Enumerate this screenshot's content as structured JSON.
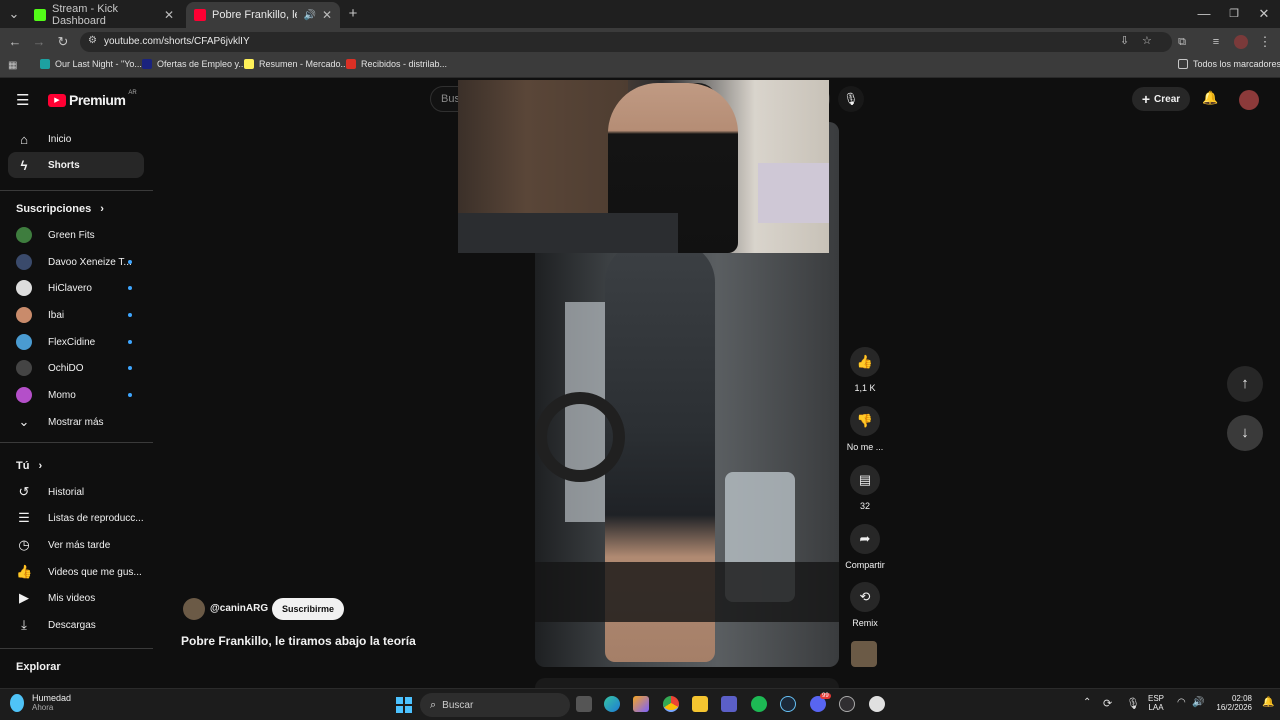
{
  "browser": {
    "tabs": [
      {
        "title": "Stream - Kick Dashboard",
        "favicon_color": "#53fc18",
        "active": false
      },
      {
        "title": "Pobre Frankillo, le tiramos a",
        "favicon_color": "#ff0033",
        "active": true
      }
    ],
    "new_tab_icon": "plus-icon",
    "url": "youtube.com/shorts/CFAP6jvklIY",
    "bookmarks": [
      {
        "label": "Our Last Night - \"Yo...",
        "color": "#1da1a1"
      },
      {
        "label": "Ofertas de Empleo y...",
        "color": "#1a237e"
      },
      {
        "label": "Resumen - Mercado...",
        "color": "#fff159"
      },
      {
        "label": "Recibidos - distrilab...",
        "color": "#d93025"
      }
    ],
    "all_bookmarks": "Todos los marcadores"
  },
  "youtube": {
    "logo": "Premium",
    "logo_region": "AR",
    "search_placeholder": "Buscar",
    "create_label": "Crear",
    "nav": [
      {
        "label": "Inicio",
        "icon": "home-icon"
      },
      {
        "label": "Shorts",
        "icon": "shorts-icon"
      }
    ],
    "subscriptions_title": "Suscripciones",
    "subscriptions": [
      {
        "label": "Green Fits",
        "color": "#3e7d3e",
        "dot": false
      },
      {
        "label": "Davoo Xeneize T...",
        "color": "#3a4a6b",
        "dot": true
      },
      {
        "label": "HiClavero",
        "color": "#dddddd",
        "dot": true
      },
      {
        "label": "Ibai",
        "color": "#c98b6b",
        "dot": true
      },
      {
        "label": "FlexCidine",
        "color": "#4a9bd1",
        "dot": true
      },
      {
        "label": "OchiDO",
        "color": "#444444",
        "dot": true
      },
      {
        "label": "Momo",
        "color": "#b44fc9",
        "dot": true
      }
    ],
    "show_more": "Mostrar más",
    "you_title": "Tú",
    "you_items": [
      {
        "label": "Historial",
        "icon": "history-icon"
      },
      {
        "label": "Listas de reproducc...",
        "icon": "playlists-icon"
      },
      {
        "label": "Ver más tarde",
        "icon": "clock-icon"
      },
      {
        "label": "Videos que me gus...",
        "icon": "like-icon"
      },
      {
        "label": "Mis videos",
        "icon": "my-videos-icon"
      },
      {
        "label": "Descargas",
        "icon": "download-icon"
      }
    ],
    "explore_title": "Explorar",
    "short": {
      "channel": "@caninARG",
      "subscribe": "Suscribirme",
      "title": "Pobre Frankillo, le tiramos abajo la teoría"
    },
    "actions": {
      "likes": "1,1 K",
      "dislike": "No me ...",
      "comments": "32",
      "share": "Compartir",
      "remix": "Remix"
    }
  },
  "taskbar": {
    "weather_title": "Humedad",
    "weather_sub": "Ahora",
    "search": "Buscar",
    "lang": "ESP",
    "lang_sub": "LAA",
    "time": "02:08",
    "date": "16/2/2026",
    "notification_badge": "99"
  }
}
